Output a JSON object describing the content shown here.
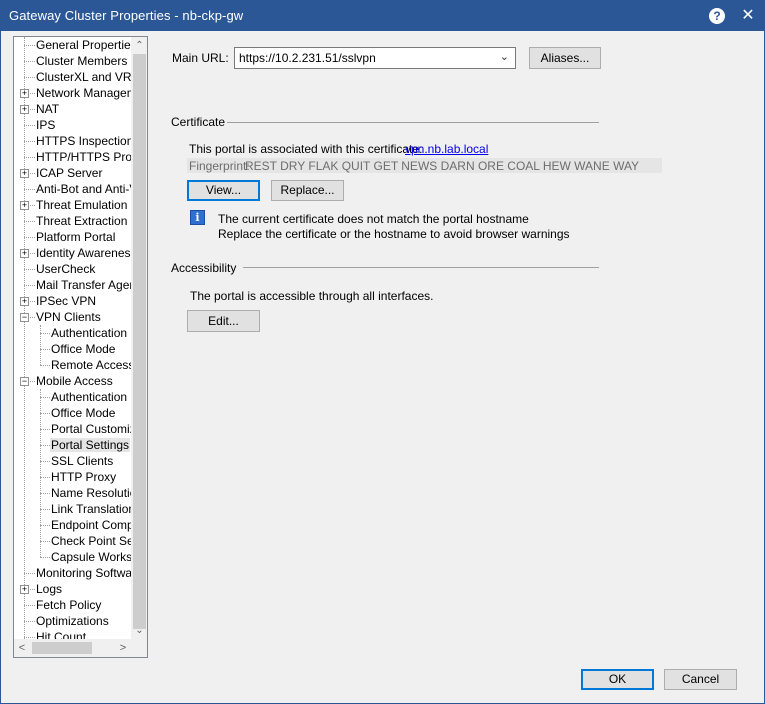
{
  "window": {
    "title": "Gateway Cluster Properties - nb-ckp-gw",
    "help_icon": "?",
    "close_icon": "✕"
  },
  "tree": {
    "items": [
      {
        "label": "General Properties",
        "level": 0,
        "expander": ""
      },
      {
        "label": "Cluster Members",
        "level": 0,
        "expander": ""
      },
      {
        "label": "ClusterXL and VRRP",
        "level": 0,
        "expander": ""
      },
      {
        "label": "Network Management",
        "level": 0,
        "expander": "+"
      },
      {
        "label": "NAT",
        "level": 0,
        "expander": "+"
      },
      {
        "label": "IPS",
        "level": 0,
        "expander": ""
      },
      {
        "label": "HTTPS Inspection",
        "level": 0,
        "expander": ""
      },
      {
        "label": "HTTP/HTTPS Proxy",
        "level": 0,
        "expander": ""
      },
      {
        "label": "ICAP Server",
        "level": 0,
        "expander": "+"
      },
      {
        "label": "Anti-Bot and Anti-Virus",
        "level": 0,
        "expander": ""
      },
      {
        "label": "Threat Emulation",
        "level": 0,
        "expander": "+"
      },
      {
        "label": "Threat Extraction",
        "level": 0,
        "expander": ""
      },
      {
        "label": "Platform Portal",
        "level": 0,
        "expander": ""
      },
      {
        "label": "Identity Awareness",
        "level": 0,
        "expander": "+"
      },
      {
        "label": "UserCheck",
        "level": 0,
        "expander": ""
      },
      {
        "label": "Mail Transfer Agent",
        "level": 0,
        "expander": ""
      },
      {
        "label": "IPSec VPN",
        "level": 0,
        "expander": "+"
      },
      {
        "label": "VPN Clients",
        "level": 0,
        "expander": "−"
      },
      {
        "label": "Authentication",
        "level": 1,
        "expander": ""
      },
      {
        "label": "Office Mode",
        "level": 1,
        "expander": ""
      },
      {
        "label": "Remote Access",
        "level": 1,
        "expander": ""
      },
      {
        "label": "Mobile Access",
        "level": 0,
        "expander": "−"
      },
      {
        "label": "Authentication",
        "level": 1,
        "expander": ""
      },
      {
        "label": "Office Mode",
        "level": 1,
        "expander": ""
      },
      {
        "label": "Portal Customization",
        "level": 1,
        "expander": ""
      },
      {
        "label": "Portal Settings",
        "level": 1,
        "expander": "",
        "selected": true
      },
      {
        "label": "SSL Clients",
        "level": 1,
        "expander": ""
      },
      {
        "label": "HTTP Proxy",
        "level": 1,
        "expander": ""
      },
      {
        "label": "Name Resolution",
        "level": 1,
        "expander": ""
      },
      {
        "label": "Link Translation",
        "level": 1,
        "expander": ""
      },
      {
        "label": "Endpoint Compliance",
        "level": 1,
        "expander": ""
      },
      {
        "label": "Check Point Secure Workspace",
        "level": 1,
        "expander": ""
      },
      {
        "label": "Capsule Workspace",
        "level": 1,
        "expander": ""
      },
      {
        "label": "Monitoring Software Blade",
        "level": 0,
        "expander": ""
      },
      {
        "label": "Logs",
        "level": 0,
        "expander": "+"
      },
      {
        "label": "Fetch Policy",
        "level": 0,
        "expander": ""
      },
      {
        "label": "Optimizations",
        "level": 0,
        "expander": ""
      },
      {
        "label": "Hit Count",
        "level": 0,
        "expander": ""
      }
    ],
    "scroll_up_icon": "⌃",
    "scroll_down_icon": "⌄",
    "scroll_left_icon": "<",
    "scroll_right_icon": ">"
  },
  "main_url": {
    "label": "Main URL:",
    "value": "https://10.2.231.51/sslvpn",
    "dropdown_icon": "⌄",
    "aliases_button": "Aliases..."
  },
  "certificate": {
    "header": "Certificate",
    "assoc_text": "This portal is associated with this certificate:",
    "cert_link": "vpn.nb.lab.local",
    "fingerprint_label": "Fingerprint:",
    "fingerprint_value": "REST DRY FLAK QUIT GET NEWS DARN ORE COAL HEW WANE WAY",
    "view_button": "View...",
    "replace_button": "Replace...",
    "info_icon": "i",
    "warning_line1": "The current certificate does not match the portal hostname",
    "warning_line2": "Replace the certificate or the hostname to avoid browser warnings"
  },
  "accessibility": {
    "header": "Accessibility",
    "text": "The portal is accessible through all interfaces.",
    "edit_button": "Edit..."
  },
  "footer": {
    "ok_button": "OK",
    "cancel_button": "Cancel"
  },
  "colors": {
    "titlebar": "#2b5797",
    "link": "#0000ee",
    "focus": "#0078d7"
  }
}
